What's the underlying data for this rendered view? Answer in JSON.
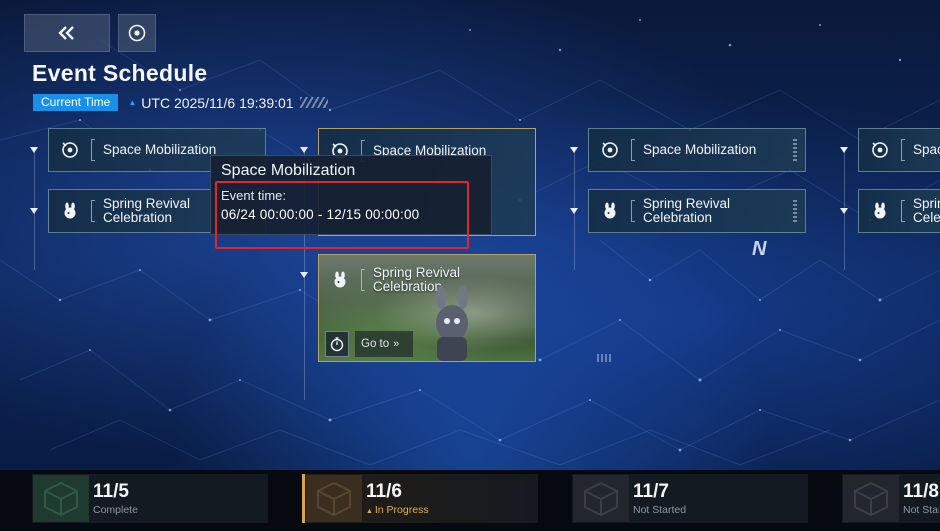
{
  "header": {
    "title": "Event Schedule",
    "current_time_label": "Current Time",
    "current_time_value": "UTC 2025/11/6 19:39:01"
  },
  "columns": [
    {
      "cards": [
        {
          "label": "Space Mobilization",
          "icon": "target-icon",
          "selected": true
        },
        {
          "label_line1": "Spring Revival",
          "label_line2": "Celebration",
          "icon": "bunny-icon",
          "selected": false
        }
      ]
    },
    {
      "cards": [
        {
          "label": "Space Mobilization",
          "icon": "target-icon"
        },
        {
          "label_line1": "Spring Revival",
          "label_line2": "Celebration",
          "icon": "bunny-icon",
          "goto_label": "Go to"
        }
      ]
    },
    {
      "cards": [
        {
          "label": "Space Mobilization",
          "icon": "target-icon"
        },
        {
          "label_line1": "Spring Revival",
          "label_line2": "Celebration",
          "icon": "bunny-icon"
        }
      ]
    },
    {
      "cards": [
        {
          "label": "Spac",
          "icon": "target-icon"
        },
        {
          "label_line1": "Sprin",
          "label_line2": "Celeb",
          "icon": "bunny-icon"
        }
      ]
    }
  ],
  "tooltip": {
    "title": "Space Mobilization",
    "event_time_label": "Event time:",
    "event_time_range": "06/24 00:00:00 - 12/15 00:00:00"
  },
  "days": [
    {
      "date": "11/5",
      "status": "Complete",
      "current": false
    },
    {
      "date": "11/6",
      "status": "In Progress",
      "current": true
    },
    {
      "date": "11/7",
      "status": "Not Started",
      "current": false
    },
    {
      "date": "11/8",
      "status": "Not Started",
      "current": false
    }
  ],
  "colors": {
    "accent_blue": "#1690e8",
    "highlight_red": "#e1252a",
    "in_progress_gold": "#e0b048",
    "active_border": "#b7a064"
  }
}
